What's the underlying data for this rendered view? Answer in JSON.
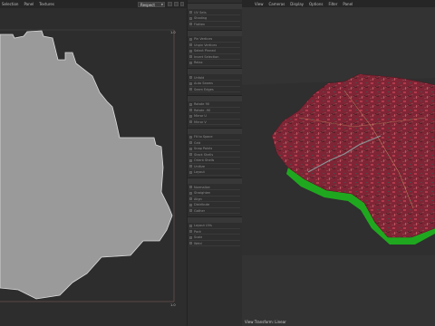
{
  "uv_editor": {
    "menu": [
      "Selection",
      "Panel",
      "Textures"
    ],
    "dropdown": "Respect",
    "axis_top": "1.0",
    "axis_bottom": "1.0"
  },
  "side_panel": {
    "groups": [
      [
        "UV Sets",
        "Shading",
        "Flatten"
      ],
      [
        "Pin Vertices",
        "Unpin Vertices",
        "Select Pinned",
        "Invert Selection",
        "Relax"
      ],
      [
        "Unfold",
        "Auto Seams",
        "Seam Edges"
      ],
      [
        "Rotate 90",
        "Rotate -90",
        "Mirror U",
        "Mirror V"
      ],
      [
        "Fit to Space",
        "Grid",
        "Snap Points",
        "Stack Shells",
        "Orient Shells",
        "Unitize",
        "Layout"
      ],
      [
        "Normalize",
        "Straighten",
        "Align",
        "Distribute",
        "Gather"
      ],
      [
        "Layout UVs",
        "Pack",
        "Scale",
        "Weld"
      ]
    ]
  },
  "viewport": {
    "menu": [
      "View",
      "Cameras",
      "Display",
      "Options",
      "Filter",
      "Panel"
    ],
    "perspective_label": "Perspective",
    "camera_label": "Default Camera",
    "move_label": "Move",
    "status": "View Transform: Linear"
  },
  "colors": {
    "terrain": "#8a2a3a",
    "extrusion": "#1fa81f",
    "uv_shape": "#9a9a9a"
  }
}
